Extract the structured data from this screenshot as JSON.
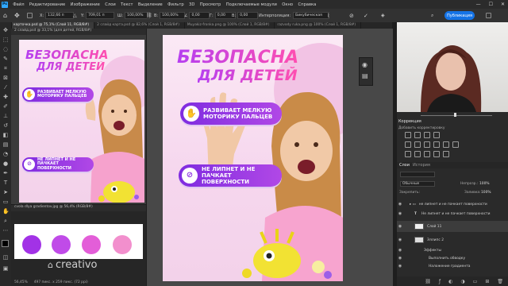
{
  "app": {
    "logo": "Ps",
    "accent": "#31a8ff"
  },
  "menu": [
    "Файл",
    "Редактирование",
    "Изображение",
    "Слои",
    "Текст",
    "Выделение",
    "Фильтр",
    "3D",
    "Просмотр",
    "Подключаемые модули",
    "Окно",
    "Справка"
  ],
  "window_controls": [
    "—",
    "☐",
    "✕"
  ],
  "options": {
    "x": "132,66 п",
    "y": "709,01 п",
    "w": "100,00%",
    "h": "100,00%",
    "angle": "0,00",
    "skew_h": "0,00",
    "skew_v": "0,00",
    "interp_label": "Интерполяция:",
    "interp_value": "Бикубическая",
    "share": "Публикация"
  },
  "tabs": [
    "карточка.psd @ 75,1% (Слой 11, RGB/8#)",
    "2 слайд карта.psd @ 82,6% (Слой 1, RGB/8#)",
    "Muyakiz-fronka.png @ 100% (Слой 1, RGB/8#)",
    "razvody ruka.png @ 100% (Слой 1, RGB/8#)"
  ],
  "doc1_tab": "2 слайд.psd @ 33,1% (для детей, RGB/8#)",
  "doc2_tab": "cvola dlya gradientov.jpg @ 56,4% (RGB/8#)",
  "poster": {
    "title1": "БЕЗОПАСНА",
    "title2": "ДЛЯ ДЕТЕЙ",
    "pill1": "РАЗВИВАЕТ МЕЛКУЮ МОТОРИКУ ПАЛЬЦЕВ",
    "pill2": "НЕ ЛИПНЕТ И НЕ ПАЧКАЕТ ПОВЕРХНОСТИ",
    "title_gradient": [
      "#b63ff0",
      "#ff4fb0"
    ],
    "pill_color": "#8a30e2"
  },
  "swatches": [
    "#a232e6",
    "#c04be8",
    "#e35ed8",
    "#f28fcd"
  ],
  "status": {
    "zoom": "56,45%",
    "info": "497 пикс. x 259 пикс. (72 ppi)"
  },
  "brand": "creativo",
  "panels": {
    "corrections": "Коррекция",
    "add_corr": "Добавить корректировку",
    "layers_tab": "Слои",
    "history_tab": "История",
    "blend_mode": "Обычные",
    "opacity_label": "Непрозр.:",
    "opacity": "100%",
    "lock_label": "Закрепить:",
    "fill_label": "Заливка:",
    "fill": "100%",
    "layers": [
      {
        "name": "не липнет и не пачкает поверхности",
        "kind": "group"
      },
      {
        "name": "Не липнет и не пачкает  поверхности",
        "kind": "text"
      },
      {
        "name": "Слой 11",
        "kind": "layer"
      },
      {
        "name": "Эллипс 2",
        "kind": "shape"
      },
      {
        "name": "Эффекты",
        "kind": "fx"
      },
      {
        "name": "Выполнить обводку",
        "kind": "fx"
      },
      {
        "name": "Наложение градиента",
        "kind": "fx"
      }
    ]
  }
}
